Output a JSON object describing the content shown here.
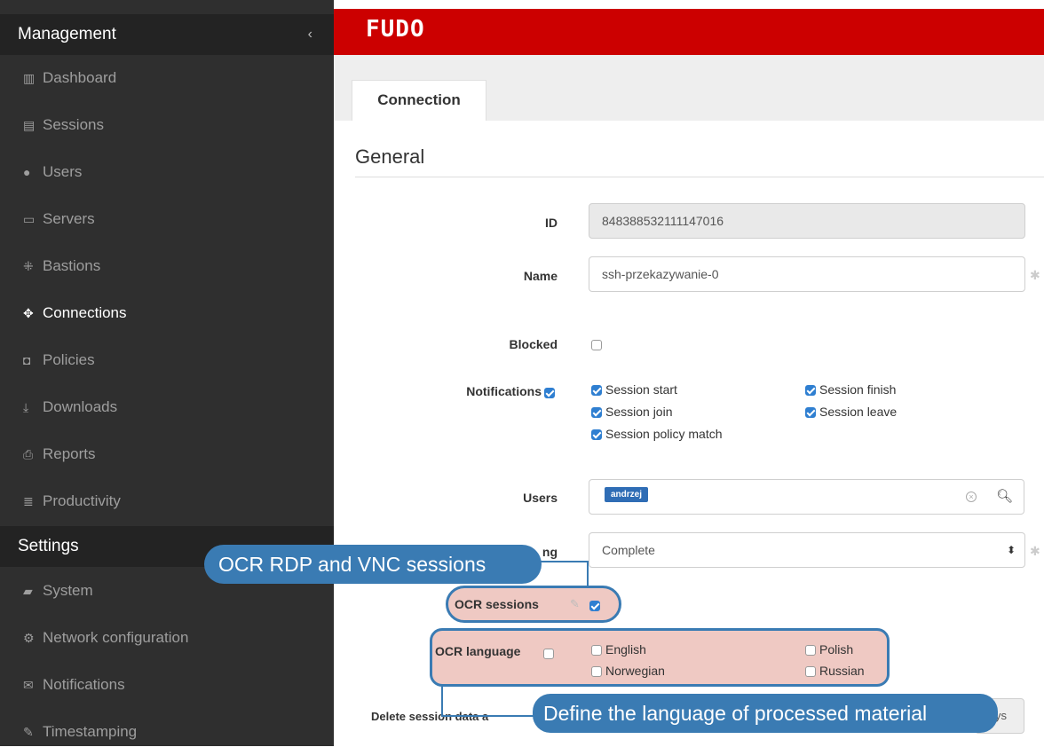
{
  "sidebar": {
    "management_title": "Management",
    "collapse_icon": "chevron-left-icon",
    "items": [
      {
        "label": "Dashboard",
        "icon": "chart-icon"
      },
      {
        "label": "Sessions",
        "icon": "film-icon"
      },
      {
        "label": "Users",
        "icon": "users-icon"
      },
      {
        "label": "Servers",
        "icon": "server-icon"
      },
      {
        "label": "Bastions",
        "icon": "bastion-icon"
      },
      {
        "label": "Connections",
        "icon": "arrows-icon"
      },
      {
        "label": "Policies",
        "icon": "shield-icon"
      },
      {
        "label": "Downloads",
        "icon": "download-icon"
      },
      {
        "label": "Reports",
        "icon": "printer-icon"
      },
      {
        "label": "Productivity",
        "icon": "list-icon"
      }
    ],
    "active_item": "Connections",
    "settings_title": "Settings",
    "settings_items": [
      {
        "label": "System",
        "icon": "folder-icon"
      },
      {
        "label": "Network configuration",
        "icon": "cogs-icon"
      },
      {
        "label": "Notifications",
        "icon": "envelope-icon"
      },
      {
        "label": "Timestamping",
        "icon": "edit-icon"
      }
    ]
  },
  "header": {
    "logo": "FUDO",
    "brand_color": "#cc0000"
  },
  "tabs": [
    {
      "label": "Connection",
      "active": true
    }
  ],
  "section_title": "General",
  "form": {
    "id_label": "ID",
    "id_value": "848388532111147016",
    "name_label": "Name",
    "name_value": "ssh-przekazywanie-0",
    "blocked_label": "Blocked",
    "blocked_checked": false,
    "notifications_label": "Notifications",
    "notifications_checked": true,
    "notification_options": [
      {
        "label": "Session start",
        "checked": true
      },
      {
        "label": "Session finish",
        "checked": true
      },
      {
        "label": "Session join",
        "checked": true
      },
      {
        "label": "Session leave",
        "checked": true
      },
      {
        "label": "Session policy match",
        "checked": true
      }
    ],
    "users_label": "Users",
    "users_tags": [
      "andrzej"
    ],
    "recording_label_partial": "ng",
    "recording_value": "Complete",
    "ocr_sessions_label": "OCR sessions",
    "ocr_sessions_checked": true,
    "ocr_language_label": "OCR language",
    "ocr_language_checked": false,
    "ocr_languages": [
      {
        "label": "English",
        "checked": false
      },
      {
        "label": "Polish",
        "checked": false
      },
      {
        "label": "Norwegian",
        "checked": false
      },
      {
        "label": "Russian",
        "checked": false
      }
    ],
    "delete_label_partial": "Delete session data a",
    "delete_suffix_partial": "ys"
  },
  "callouts": {
    "ocr_rdp": "OCR RDP and VNC sessions",
    "define_language": "Define the language of processed material",
    "accent_color": "#3a7bb3"
  }
}
